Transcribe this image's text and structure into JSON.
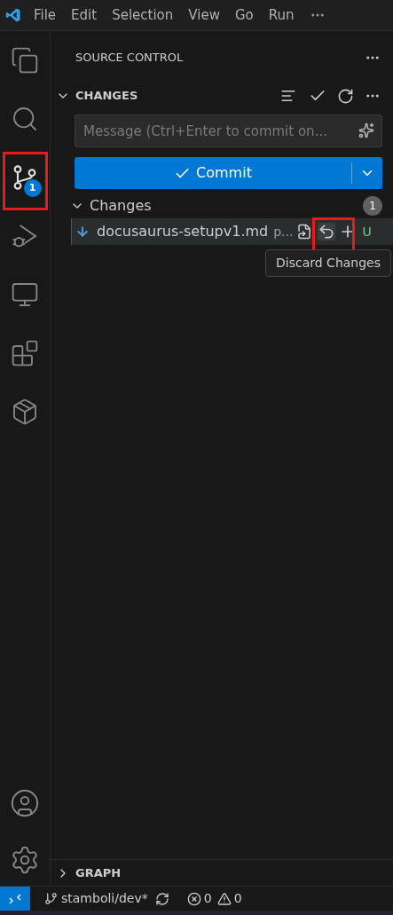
{
  "menu_bar": [
    "File",
    "Edit",
    "Selection",
    "View",
    "Go",
    "Run"
  ],
  "activity_bar": [
    {
      "kind": "files",
      "selected": false,
      "highlighted": false
    },
    {
      "kind": "search",
      "selected": false,
      "highlighted": false
    },
    {
      "kind": "source-control",
      "selected": true,
      "highlighted": true,
      "badge": "1"
    },
    {
      "kind": "run-debug",
      "selected": false,
      "highlighted": false
    },
    {
      "kind": "remote",
      "selected": false,
      "highlighted": false
    },
    {
      "kind": "extensions",
      "selected": false,
      "highlighted": false
    },
    {
      "kind": "containers",
      "selected": false,
      "highlighted": false
    }
  ],
  "sidebar": {
    "title": "SOURCE CONTROL",
    "section": {
      "title": "CHANGES",
      "expanded": true
    },
    "message_field": {
      "placeholder": "Message (Ctrl+Enter to commit on..."
    },
    "commit_button": {
      "label": "Commit"
    },
    "group": {
      "title": "Changes",
      "count": "1",
      "expanded": true,
      "files": [
        {
          "name": "docusaurus-setupv1.md",
          "path": "p...",
          "status": "U",
          "discard_highlighted": true
        }
      ]
    },
    "tooltip": "Discard Changes",
    "graph": {
      "title": "GRAPH",
      "expanded": false
    }
  },
  "status_bar": {
    "branch": "stamboli/dev*",
    "errors": "0",
    "warnings": "0"
  }
}
